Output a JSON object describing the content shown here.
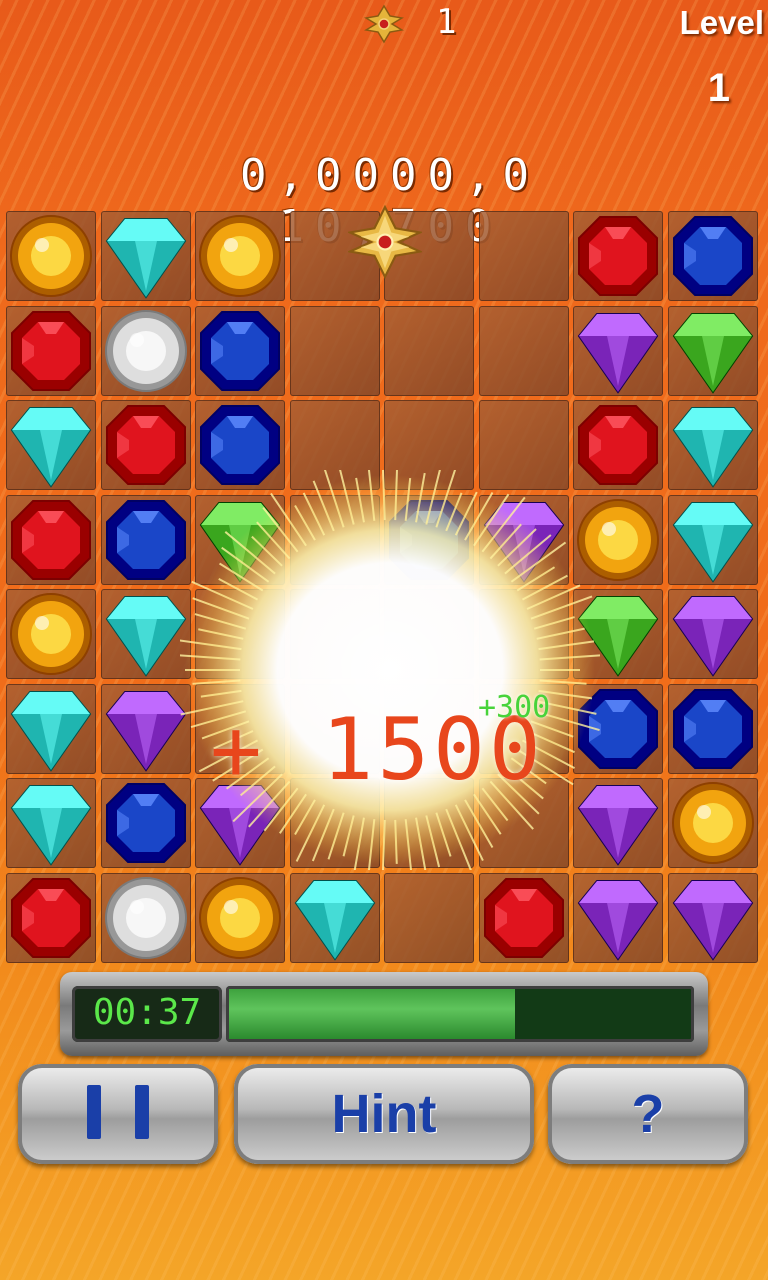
{
  "header": {
    "medal_icon": "gold-cross-medal-icon",
    "medal_count": "1",
    "level_label": "Level",
    "level_value": "1",
    "score": "0,0000,0 10,700"
  },
  "board": {
    "rows": 8,
    "cols": 8,
    "grid": [
      [
        "yellow-round",
        "teal-diamond",
        "yellow-round",
        "empty",
        "empty",
        "empty",
        "red-octagon",
        "blue-octagon"
      ],
      [
        "red-octagon",
        "white-round",
        "blue-octagon",
        "empty",
        "empty",
        "empty",
        "purple-diamond",
        "green-diamond"
      ],
      [
        "teal-diamond",
        "red-octagon",
        "blue-octagon",
        "empty",
        "empty",
        "empty",
        "red-octagon",
        "teal-diamond"
      ],
      [
        "red-octagon",
        "blue-octagon",
        "green-diamond",
        "empty",
        "blue-octagon",
        "purple-diamond",
        "yellow-round",
        "teal-diamond"
      ],
      [
        "yellow-round",
        "teal-diamond",
        "empty",
        "empty",
        "empty",
        "empty",
        "green-diamond",
        "purple-diamond"
      ],
      [
        "teal-diamond",
        "purple-diamond",
        "empty",
        "empty",
        "empty",
        "empty",
        "blue-octagon",
        "blue-octagon"
      ],
      [
        "teal-diamond",
        "blue-octagon",
        "purple-diamond",
        "empty",
        "empty",
        "empty",
        "purple-diamond",
        "yellow-round"
      ],
      [
        "red-octagon",
        "white-round",
        "yellow-round",
        "teal-diamond",
        "empty",
        "red-octagon",
        "purple-diamond",
        "purple-diamond"
      ]
    ],
    "medal_piece": "gold-cross-medal-icon",
    "colors": {
      "red": "#e0141e",
      "blue": "#1a46c8",
      "teal": "#1fb5b0",
      "green": "#3aa61e",
      "purple": "#7a24b8",
      "yellow": "#f2a40f",
      "white": "#dedede"
    }
  },
  "popup": {
    "bonus_text": "+ 1500",
    "small_bonus_text": "+300"
  },
  "timer": {
    "time": "00:37",
    "progress": 0.62
  },
  "buttons": {
    "pause_icon": "pause-icon",
    "hint_label": "Hint",
    "help_label": "?"
  }
}
